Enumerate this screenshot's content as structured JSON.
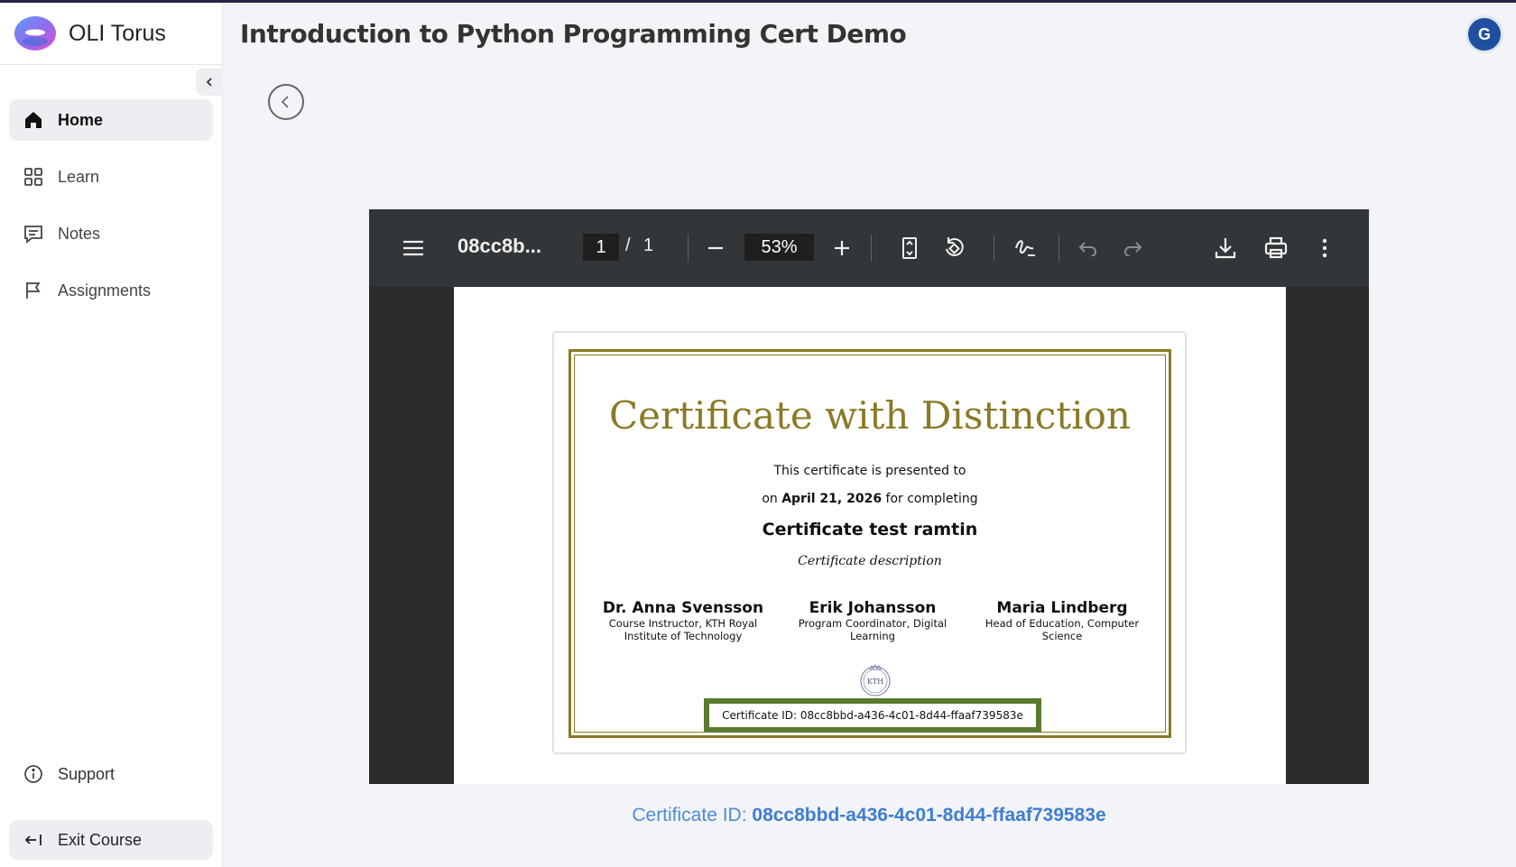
{
  "app": {
    "name_primary": "OLI",
    "name_secondary": " Torus",
    "course_title": "Introduction to Python Programming Cert Demo",
    "avatar_initial": "G"
  },
  "sidebar": {
    "items": [
      {
        "label": "Home",
        "icon": "home-icon",
        "active": true
      },
      {
        "label": "Learn",
        "icon": "grid-icon",
        "active": false
      },
      {
        "label": "Notes",
        "icon": "message-icon",
        "active": false
      },
      {
        "label": "Assignments",
        "icon": "flag-icon",
        "active": false
      }
    ],
    "support_label": "Support",
    "exit_label": "Exit Course"
  },
  "viewer": {
    "doc_name": "08cc8b...",
    "current_page": "1",
    "page_separator": "/",
    "total_pages": "1",
    "zoom": "53%"
  },
  "certificate": {
    "title": "Certificate with Distinction",
    "presented_to": "This certificate is presented to",
    "date_prefix": "on ",
    "date": "April 21, 2026",
    "date_suffix": " for completing",
    "course_name": "Certificate test ramtin",
    "description": "Certificate description",
    "signers": [
      {
        "name": "Dr. Anna Svensson",
        "role": "Course Instructor, KTH Royal Institute of Technology"
      },
      {
        "name": "Erik Johansson",
        "role": "Program Coordinator, Digital Learning"
      },
      {
        "name": "Maria Lindberg",
        "role": "Head of Education, Computer Science"
      }
    ],
    "seal_text": "KTH",
    "id_line": "Certificate ID: 08cc8bbd-a436-4c01-8d44-ffaaf739583e"
  },
  "footer": {
    "id_label": "Certificate ID: ",
    "id_value": "08cc8bbd-a436-4c01-8d44-ffaaf739583e"
  },
  "colors": {
    "accent_gold": "#8a7a25",
    "id_border_green": "#5a7a2e",
    "link_blue": "#3d7ed0",
    "avatar_blue": "#1f4f9e"
  }
}
